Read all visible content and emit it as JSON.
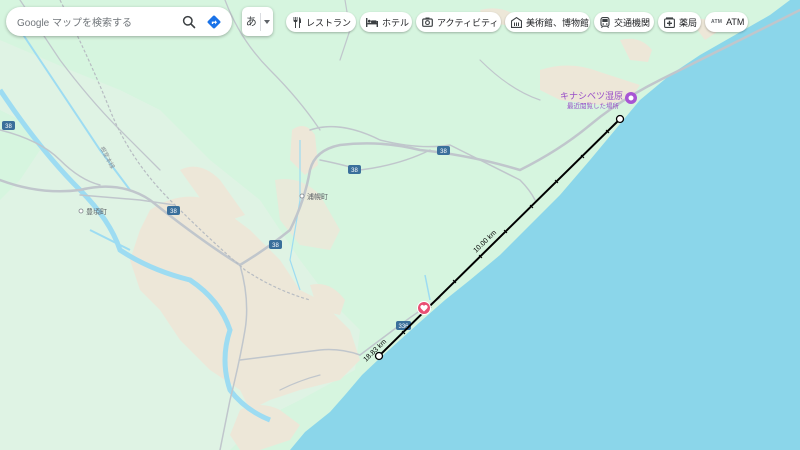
{
  "search": {
    "placeholder": "Google マップを検索する"
  },
  "language": {
    "current": "あ"
  },
  "chips": [
    {
      "label": "レストラン",
      "icon": "restaurant-icon"
    },
    {
      "label": "ホテル",
      "icon": "hotel-icon"
    },
    {
      "label": "アクティビティ",
      "icon": "camera-icon"
    },
    {
      "label": "美術館、博物館",
      "icon": "museum-icon"
    },
    {
      "label": "交通機関",
      "icon": "transit-icon"
    },
    {
      "label": "薬局",
      "icon": "pharmacy-icon"
    },
    {
      "label": "ATM",
      "icon": "atm-icon",
      "badge": "ATM"
    }
  ],
  "map": {
    "places": {
      "poi_name": "キナシベツ湿原",
      "poi_subtitle": "最近閲覧した場所",
      "town_a": "浦幌町",
      "town_b": "豊頃町"
    },
    "road_labels": {
      "r38": "38",
      "r336": "336",
      "route_name": "根室本線"
    },
    "measure": {
      "total": "18.83 km",
      "segment": "10.00 km"
    },
    "colors": {
      "land": "#d6f5df",
      "sea": "#8bd6ea",
      "terrain": "#ede7d8",
      "measure_line": "#000000"
    }
  }
}
